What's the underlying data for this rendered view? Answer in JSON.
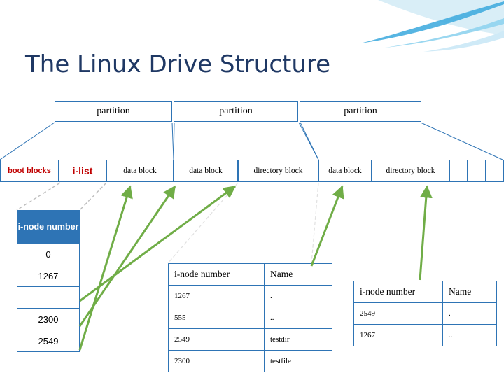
{
  "slide": {
    "title": "The Linux Drive Structure"
  },
  "partitions": [
    {
      "label": "partition"
    },
    {
      "label": "partition"
    },
    {
      "label": "partition"
    }
  ],
  "blocks": [
    {
      "label": "boot blocks"
    },
    {
      "label": "i-list"
    },
    {
      "label": "data block"
    },
    {
      "label": "data block"
    },
    {
      "label": "directory block"
    },
    {
      "label": "data block"
    },
    {
      "label": "directory block"
    },
    {
      "label": ""
    },
    {
      "label": ""
    },
    {
      "label": ""
    }
  ],
  "inode_table": {
    "header": "i-node number",
    "rows": [
      {
        "value": "0"
      },
      {
        "value": "1267"
      },
      {
        "value": ""
      },
      {
        "value": "2300"
      },
      {
        "value": "2549"
      }
    ]
  },
  "directory_table_1": {
    "headers": {
      "number": "i-node number",
      "name": "Name"
    },
    "rows": [
      {
        "number": "1267",
        "name": "."
      },
      {
        "number": "555",
        "name": ".."
      },
      {
        "number": "2549",
        "name": "testdir"
      },
      {
        "number": "2300",
        "name": "testfile"
      }
    ]
  },
  "directory_table_2": {
    "headers": {
      "number": "i-node number",
      "name": "Name"
    },
    "rows": [
      {
        "number": "2549",
        "name": "."
      },
      {
        "number": "1267",
        "name": ".."
      }
    ]
  },
  "colors": {
    "title": "#1f3864",
    "border": "#2e74b5",
    "header_fill": "#2e74b5",
    "accent_red": "#c00000",
    "arrow_green": "#70ad47",
    "swoosh_blue": "#2e9fd7"
  }
}
